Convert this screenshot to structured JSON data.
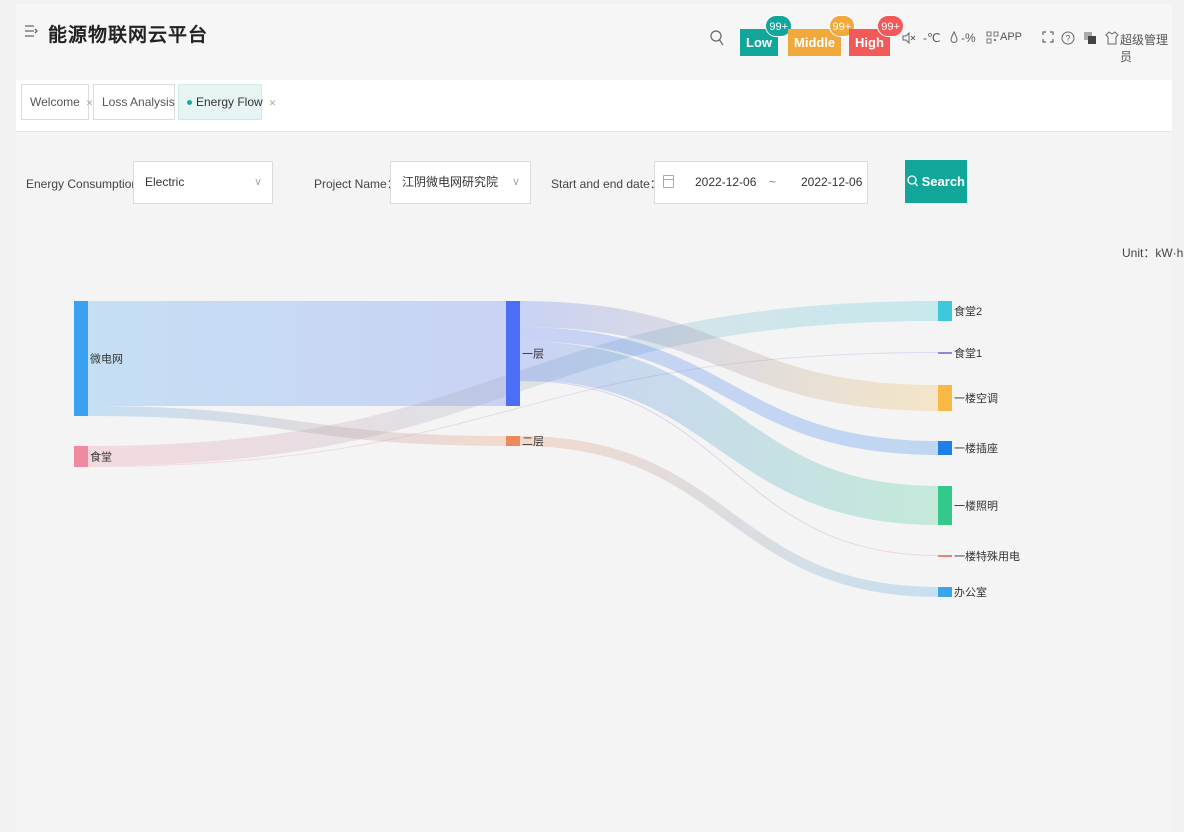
{
  "header": {
    "title": "能源物联网云平台",
    "alarms": [
      {
        "label": "Low",
        "count": "99+",
        "color": "#12a69b"
      },
      {
        "label": "Middle",
        "count": "99+",
        "color": "#f0a93a"
      },
      {
        "label": "High",
        "count": "99+",
        "color": "#f25a5a"
      }
    ],
    "weather_temp": "-℃",
    "weather_humidity": "-%",
    "app_label": "APP",
    "user_name": "超级管理员"
  },
  "tabs": [
    {
      "label": "Welcome"
    },
    {
      "label": "Loss Analysis"
    },
    {
      "label": "Energy Flow"
    }
  ],
  "filters": {
    "energy_label": "Energy Consumption：",
    "energy_value": "Electric",
    "project_label": "Project Name：",
    "project_value": "江阴微电网研究院",
    "date_label": "Start and end date：",
    "date_start": "2022-12-06",
    "date_sep": "~",
    "date_end": "2022-12-06",
    "search_label": "Search"
  },
  "unit": "Unit：kW·h",
  "chart_data": {
    "type": "sankey",
    "nodes": [
      {
        "name": "微电网",
        "color": "#3aa0f0"
      },
      {
        "name": "食堂",
        "color": "#f08aa0"
      },
      {
        "name": "一层",
        "color": "#4b6ef5"
      },
      {
        "name": "二层",
        "color": "#f0895a"
      },
      {
        "name": "食堂2",
        "color": "#3cc8d8"
      },
      {
        "name": "食堂1",
        "color": "#8a8ae0"
      },
      {
        "name": "一楼空调",
        "color": "#f7b944"
      },
      {
        "name": "一楼插座",
        "color": "#1f7fe8"
      },
      {
        "name": "一楼照明",
        "color": "#34c98a"
      },
      {
        "name": "一楼特殊用电",
        "color": "#e88080"
      },
      {
        "name": "办公室",
        "color": "#3aa3ea"
      }
    ],
    "links": [
      {
        "source": "微电网",
        "target": "一层",
        "value": 105
      },
      {
        "source": "微电网",
        "target": "二层",
        "value": 10
      },
      {
        "source": "食堂",
        "target": "食堂2",
        "value": 20
      },
      {
        "source": "食堂",
        "target": "食堂1",
        "value": 1
      },
      {
        "source": "一层",
        "target": "一楼空调",
        "value": 26
      },
      {
        "source": "一层",
        "target": "一楼插座",
        "value": 14
      },
      {
        "source": "一层",
        "target": "一楼照明",
        "value": 39
      },
      {
        "source": "一层",
        "target": "一楼特殊用电",
        "value": 1
      },
      {
        "source": "二层",
        "target": "办公室",
        "value": 10
      }
    ]
  }
}
